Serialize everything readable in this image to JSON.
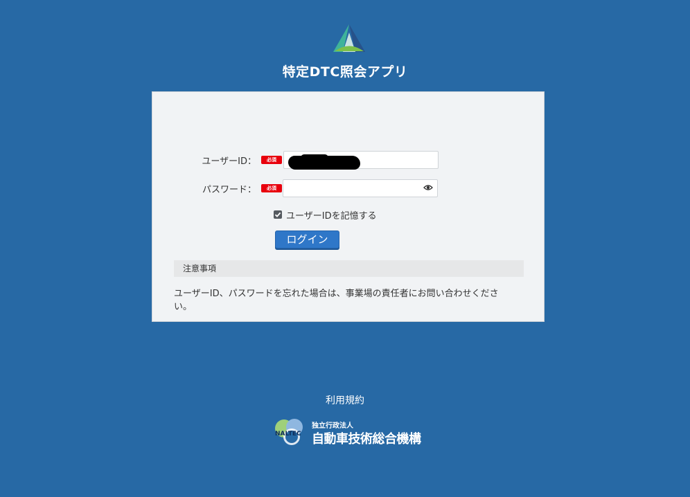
{
  "header": {
    "app_title": "特定DTC照会アプリ"
  },
  "login_form": {
    "user_id_label": "ユーザーID：",
    "password_label": "パスワード：",
    "required_badge": "必須",
    "user_id_value": "",
    "password_value": "",
    "remember_checked": true,
    "remember_label": "ユーザーIDを記憶する",
    "login_button_label": "ログイン"
  },
  "notice": {
    "header": "注意事項",
    "text": "ユーザーID、パスワードを忘れた場合は、事業場の責任者にお問い合わせください。"
  },
  "footer": {
    "terms_link": "利用規約",
    "org_subtitle": "独立行政法人",
    "org_name": "自動車技術総合機構",
    "org_logo_text": "NALTEC"
  },
  "colors": {
    "background": "#2769a5",
    "panel": "#f1f3f5",
    "primary_button": "#2f77c8",
    "required_badge": "#e8000d"
  }
}
